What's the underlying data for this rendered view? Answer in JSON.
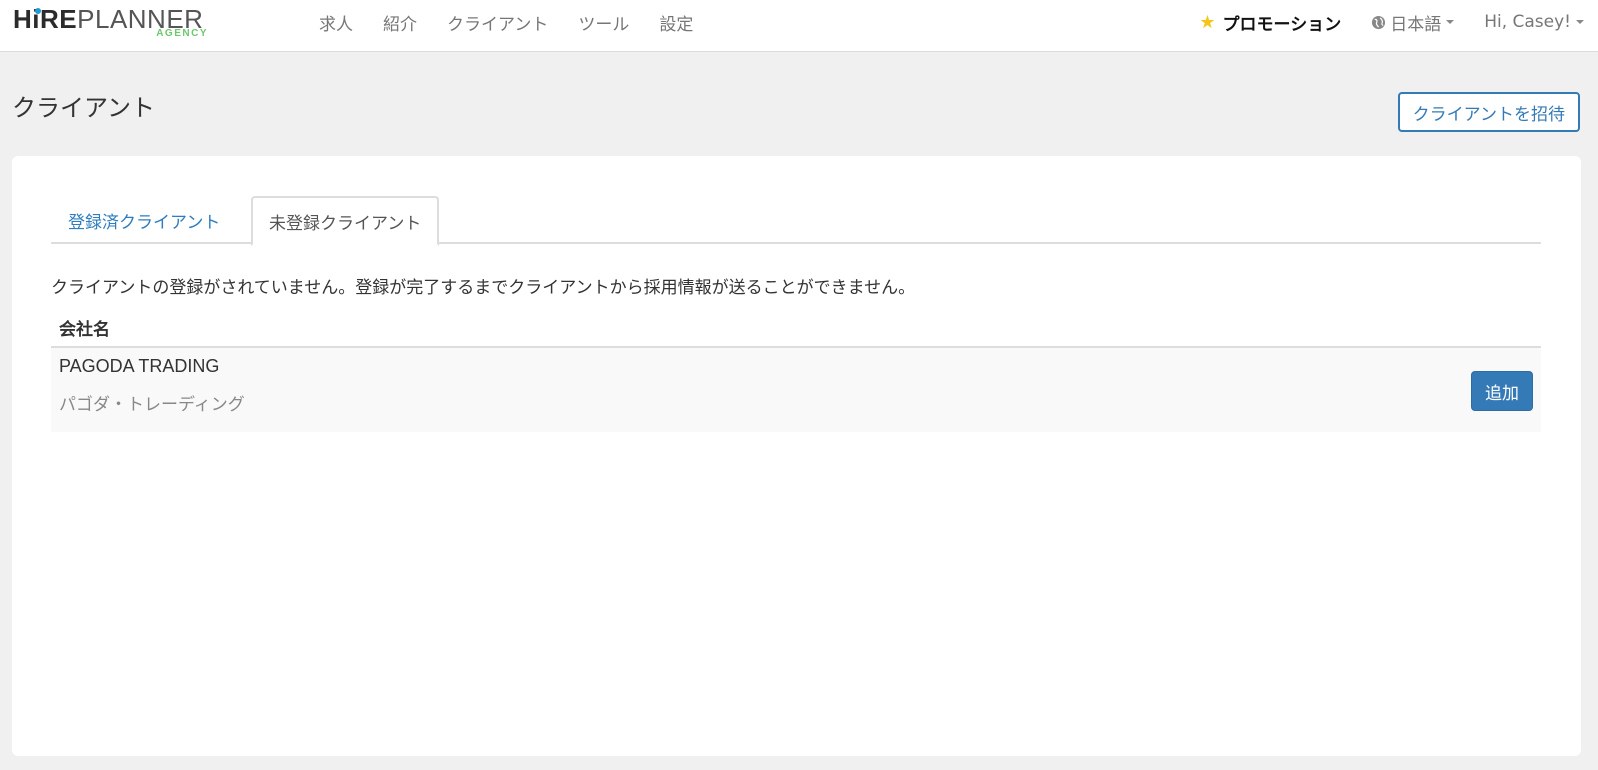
{
  "logo": {
    "text_bold_1": "H",
    "text_bold_i": "i",
    "text_bold_2": "RE",
    "text_light": "PLANNER",
    "subtext": "AGENCY"
  },
  "nav": {
    "links": [
      "求人",
      "紹介",
      "クライアント",
      "ツール",
      "設定"
    ],
    "promotion": "プロモーション",
    "language": "日本語",
    "user": "Hi, Casey!"
  },
  "page": {
    "title": "クライアント",
    "invite_button": "クライアントを招待"
  },
  "tabs": {
    "registered": "登録済クライアント",
    "unregistered": "未登録クライアント",
    "active": "unregistered"
  },
  "notice": "クライアントの登録がされていません。登録が完了するまでクライアントから採用情報が送ることができません。",
  "table": {
    "header": "会社名",
    "rows": [
      {
        "name": "PAGODA TRADING",
        "kana": "パゴダ・トレーディング",
        "action": "追加"
      }
    ]
  },
  "colors": {
    "primary": "#337ab7",
    "link": "#2f7dbf",
    "star": "#f5c518",
    "agency_green": "#6cc96c",
    "background": "#f0f0f0"
  },
  "icons": {
    "promotion": "star-icon",
    "language": "globe-icon",
    "dropdown": "caret-down-icon"
  }
}
